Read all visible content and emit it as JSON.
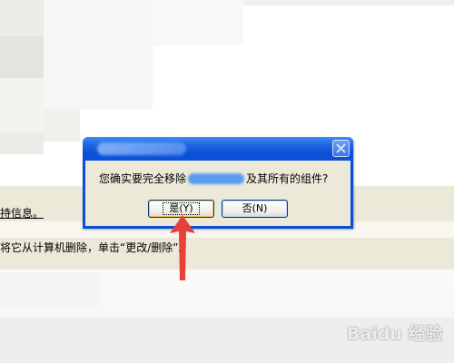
{
  "background": {
    "line1": "持信息。",
    "line2": "将它从计算机删除，单击“更改/删除”。"
  },
  "dialog": {
    "message_prefix": "您确实要完全移除",
    "message_suffix": "及其所有的组件?",
    "yes_label": "是(Y)",
    "no_label": "否(N)"
  },
  "watermark": {
    "text": "Baidu 经验"
  },
  "colors": {
    "titlebar": "#0a4ed4",
    "dialog_body": "#ece9d8",
    "arrow": "#e8403a"
  },
  "icons": {
    "close": "close-icon",
    "arrow": "arrow-up-icon"
  }
}
